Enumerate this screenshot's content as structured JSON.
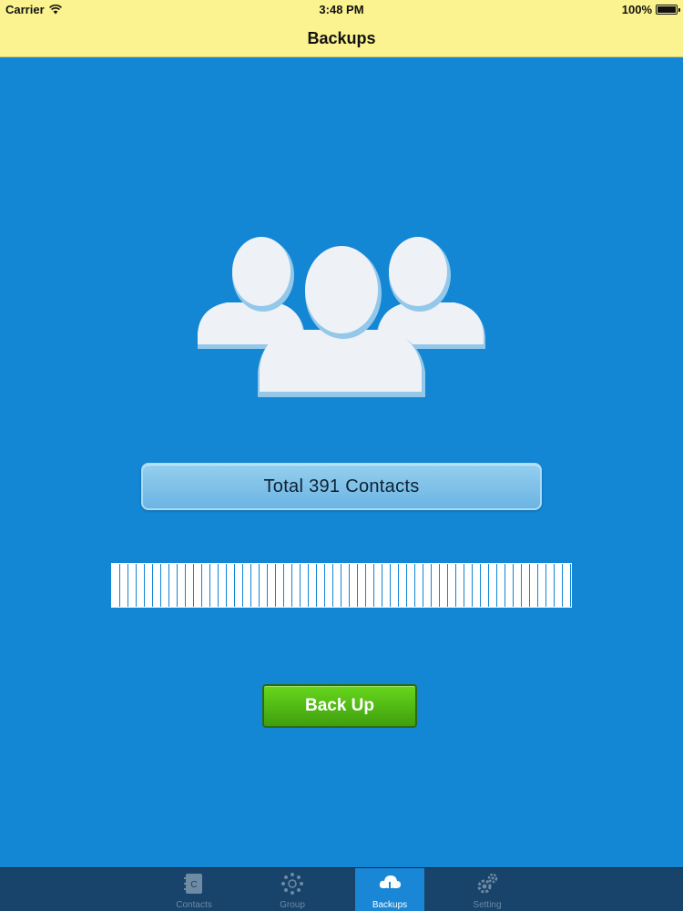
{
  "status_bar": {
    "carrier": "Carrier",
    "time": "3:48 PM",
    "battery": "100%"
  },
  "nav": {
    "title": "Backups"
  },
  "main": {
    "total_label": "Total 391 Contacts",
    "backup_button": "Back Up"
  },
  "tabs": [
    {
      "label": "Contacts",
      "icon": "contacts-book-icon",
      "active": false
    },
    {
      "label": "Group",
      "icon": "group-network-icon",
      "active": false
    },
    {
      "label": "Backups",
      "icon": "cloud-download-icon",
      "active": true
    },
    {
      "label": "Setting",
      "icon": "gears-icon",
      "active": false
    }
  ],
  "colors": {
    "nav_background": "#fbf38f",
    "content_background": "#1386d4",
    "backup_button": "#4cb912",
    "tab_bar": "#18436a"
  }
}
